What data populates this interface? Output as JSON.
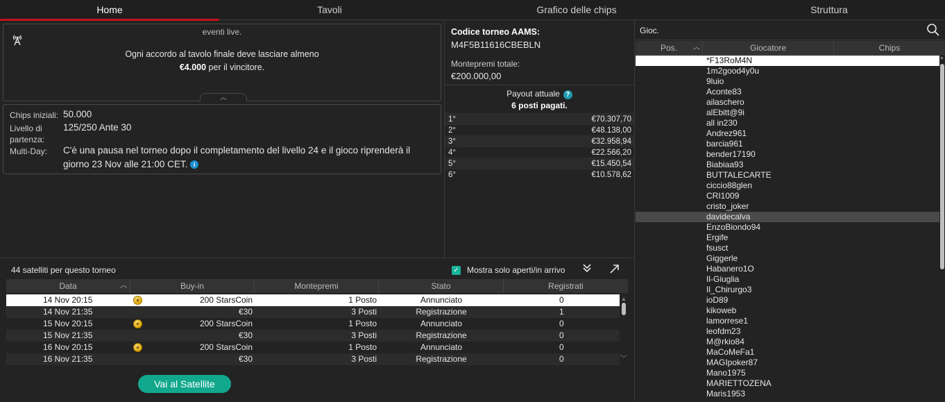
{
  "tabs": [
    {
      "label": "Home",
      "active": true
    },
    {
      "label": "Tavoli",
      "active": false
    },
    {
      "label": "Grafico delle chips",
      "active": false
    },
    {
      "label": "Struttura",
      "active": false
    }
  ],
  "notice": {
    "faded_text": "eventi live.",
    "line1": "Ogni accordo al tavolo finale deve lasciare almeno",
    "amount": "€4.000",
    "line2_rest": " per il vincitore."
  },
  "details": {
    "start_chips_label": "Chips iniziali:",
    "start_chips_value": "50.000",
    "start_level_label_1": "Livello di",
    "start_level_label_2": "partenza:",
    "start_level_value": "125/250 Ante 30",
    "multiday_label": "Multi-Day:",
    "multiday_line1": "C'è una pausa nel torneo dopo il completamento del livello 24 e il gioco riprenderà il",
    "multiday_line2": "giorno 23 Nov alle 21:00 CET."
  },
  "tournament": {
    "code_label": "Codice torneo AAMS:",
    "code_value": "M4F5B11616CBEBLN",
    "prize_label": "Montepremi totale:",
    "prize_value": "€200.000,00",
    "payout_label": "Payout attuale",
    "paid_places": "6 posti pagati.",
    "payouts": [
      {
        "pos": "1°",
        "amount": "€70.307,70"
      },
      {
        "pos": "2°",
        "amount": "€48.138,00"
      },
      {
        "pos": "3°",
        "amount": "€32.958,94"
      },
      {
        "pos": "4°",
        "amount": "€22.566,20"
      },
      {
        "pos": "5°",
        "amount": "€15.450,54"
      },
      {
        "pos": "6°",
        "amount": "€10.578,62"
      }
    ]
  },
  "satellites": {
    "count_label": "44 satelliti per questo torneo",
    "filter_label": "Mostra solo aperti/in arrivo",
    "columns": [
      "Data",
      "Buy-in",
      "Montepremi",
      "Stato",
      "Registrati"
    ],
    "rows": [
      {
        "date": "14 Nov  20:15",
        "coin": true,
        "buyin": "200 StarsCoin",
        "prize": "1 Posto",
        "status": "Annunciato",
        "reg": "0"
      },
      {
        "date": "14 Nov  21:35",
        "coin": false,
        "buyin": "€30",
        "prize": "3 Posti",
        "status": "Registrazione",
        "reg": "1"
      },
      {
        "date": "15 Nov  20:15",
        "coin": true,
        "buyin": "200 StarsCoin",
        "prize": "1 Posto",
        "status": "Annunciato",
        "reg": "0"
      },
      {
        "date": "15 Nov  21:35",
        "coin": false,
        "buyin": "€30",
        "prize": "3 Posti",
        "status": "Registrazione",
        "reg": "0"
      },
      {
        "date": "16 Nov  20:15",
        "coin": true,
        "buyin": "200 StarsCoin",
        "prize": "1 Posto",
        "status": "Annunciato",
        "reg": "0"
      },
      {
        "date": "16 Nov  21:35",
        "coin": false,
        "buyin": "€30",
        "prize": "3 Posti",
        "status": "Registrazione",
        "reg": "0"
      }
    ],
    "button_label": "Vai al Satellite"
  },
  "players": {
    "search_placeholder": "Gioc.",
    "columns": [
      "Pos.",
      "Giocatore",
      "Chips"
    ],
    "list": [
      "*F13RoM4N",
      "1m2good4y0u",
      "9luio",
      "Aconte83",
      "ailaschero",
      "alEbitt@9i",
      "all in230",
      "Andrez961",
      "barcia961",
      "bender17190",
      "Biabiaa93",
      "BUTTALECARTE",
      "ciccio88glen",
      "CRI1009",
      "cristo_joker",
      "davidecalva",
      "EnzoBiondo94",
      "Ergife",
      "fsusct",
      "Giggerle",
      "Habanero1O",
      "Il-Giuglia",
      "Il_Chirurgo3",
      "ioD89",
      "kikoweb",
      "lamorrese1",
      "leofdm23",
      "M@rkio84",
      "MaCoMeFa1",
      "MAGIpoker87",
      "Mano1975",
      "MARIETTOZENA",
      "Maris1953"
    ]
  }
}
